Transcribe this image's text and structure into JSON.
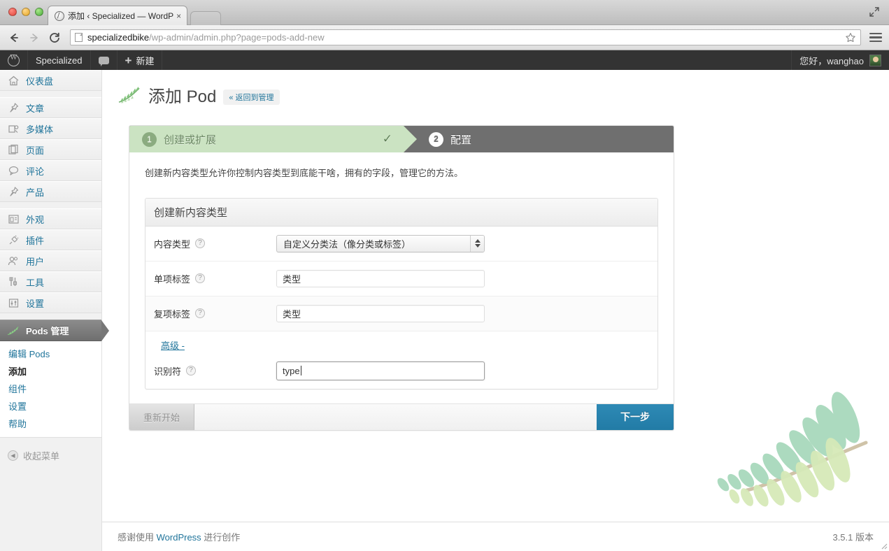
{
  "browser": {
    "tab_title": "添加 ‹ Specialized — WordP",
    "tab_close": "×",
    "url_host": "specializedbike",
    "url_path": "/wp-admin/admin.php?page=pods-add-new",
    "back_icon": "←",
    "forward_icon": "→",
    "reload_icon": "C"
  },
  "adminbar": {
    "site_name": "Specialized",
    "new_label": "新建",
    "greeting": "您好，wanghao"
  },
  "sidebar": {
    "groups": [
      {
        "items": [
          {
            "label": "仪表盘",
            "icon": "dashboard-icon"
          }
        ]
      },
      {
        "items": [
          {
            "label": "文章",
            "icon": "pin-icon"
          },
          {
            "label": "多媒体",
            "icon": "media-icon"
          },
          {
            "label": "页面",
            "icon": "pages-icon"
          },
          {
            "label": "评论",
            "icon": "comments-icon"
          },
          {
            "label": "产品",
            "icon": "pin-icon"
          }
        ]
      },
      {
        "items": [
          {
            "label": "外观",
            "icon": "appearance-icon"
          },
          {
            "label": "插件",
            "icon": "plugin-icon"
          },
          {
            "label": "用户",
            "icon": "users-icon"
          },
          {
            "label": "工具",
            "icon": "tools-icon"
          },
          {
            "label": "设置",
            "icon": "settings-icon"
          }
        ]
      }
    ],
    "current": {
      "label": "Pods 管理",
      "icon": "pods-leaf-icon"
    },
    "submenu": [
      {
        "label": "编辑 Pods",
        "current": false
      },
      {
        "label": "添加",
        "current": true
      },
      {
        "label": "组件",
        "current": false
      },
      {
        "label": "设置",
        "current": false
      },
      {
        "label": "帮助",
        "current": false
      }
    ],
    "collapse_label": "收起菜单"
  },
  "page_header": {
    "title": "添加 Pod",
    "back_link": "« 返回到管理"
  },
  "wizard": {
    "steps": [
      {
        "num": "1",
        "label": "创建或扩展",
        "state": "done",
        "check": "✓"
      },
      {
        "num": "2",
        "label": "配置",
        "state": "active"
      }
    ],
    "intro": "创建新内容类型允许你控制内容类型到底能干啥，拥有的字段，管理它的方法。",
    "box_title": "创建新内容类型",
    "fields": [
      {
        "label": "内容类型",
        "help": "?",
        "type": "select",
        "value": "自定义分类法（像分类或标签）",
        "alt": false
      },
      {
        "label": "单项标签",
        "help": "?",
        "type": "text",
        "value": "类型",
        "alt": false
      },
      {
        "label": "复项标签",
        "help": "?",
        "type": "text",
        "value": "类型",
        "alt": true
      }
    ],
    "advanced_link": "高级 -",
    "advanced_field": {
      "label": "识别符",
      "help": "?",
      "type": "text",
      "value": "type",
      "focused": true
    },
    "restart_label": "重新开始",
    "next_label": "下一步"
  },
  "footer": {
    "thanks_prefix": "感谢使用 ",
    "thanks_link": "WordPress",
    "thanks_suffix": " 进行创作",
    "version": "3.5.1 版本"
  },
  "colors": {
    "accent_blue": "#21759b",
    "next_button": "#2e8ab5",
    "step_done": "#cbe3c2",
    "step_active": "#6f6f6f",
    "adminbar": "#333333"
  }
}
